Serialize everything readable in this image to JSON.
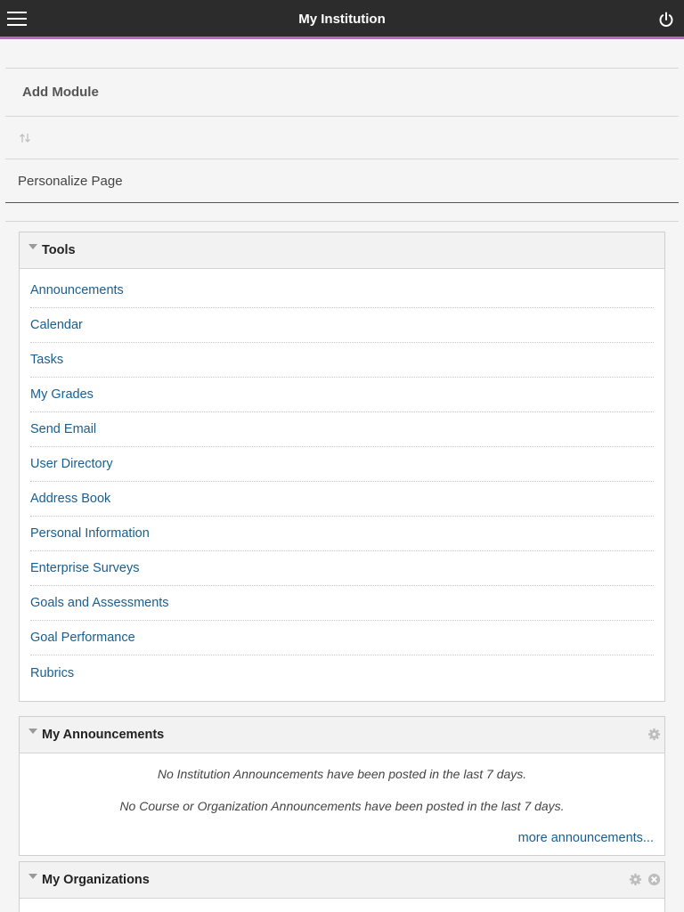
{
  "header": {
    "title": "My Institution",
    "menu_icon": "hamburger-menu-icon",
    "power_icon": "power-icon"
  },
  "page_options": {
    "add_module": "Add Module",
    "reorder_icon": "reorder-arrows-icon",
    "personalize": "Personalize Page"
  },
  "tools_module": {
    "title": "Tools",
    "items": [
      "Announcements",
      "Calendar",
      "Tasks",
      "My Grades",
      "Send Email",
      "User Directory",
      "Address Book",
      "Personal Information",
      "Enterprise Surveys",
      "Goals and Assessments",
      "Goal Performance",
      "Rubrics"
    ]
  },
  "announcements_module": {
    "title": "My Announcements",
    "messages": [
      "No Institution Announcements have been posted in the last 7 days.",
      "No Course or Organization Announcements have been posted in the last 7 days."
    ],
    "more_link": "more announcements..."
  },
  "organizations_module": {
    "title": "My Organizations"
  },
  "colors": {
    "topbar": "#2c2c2c",
    "accent": "#c062c8",
    "link": "#1a5e8f"
  }
}
